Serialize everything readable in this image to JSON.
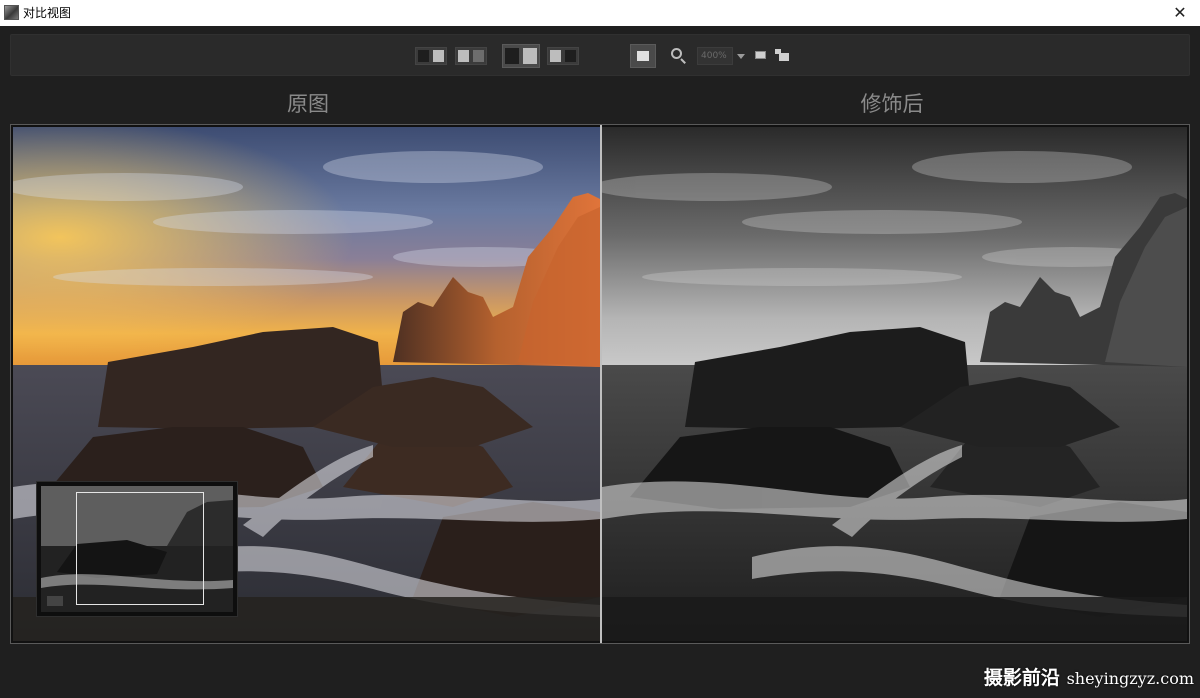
{
  "window": {
    "title": "对比视图",
    "close_glyph": "✕"
  },
  "toolbar": {
    "zoom_value": "400%",
    "buttons": [
      "side-by-side-left-view",
      "side-by-side-right-view",
      "split-view-active",
      "split-vertical-view",
      "single-view",
      "zoom-tool",
      "zoom-dropdown",
      "fit-to-window",
      "actual-size"
    ]
  },
  "panels": {
    "left_label": "原图",
    "right_label": "修饰后"
  },
  "watermark": {
    "brand": "摄影前沿",
    "domain": "sheyingzyz.com"
  }
}
